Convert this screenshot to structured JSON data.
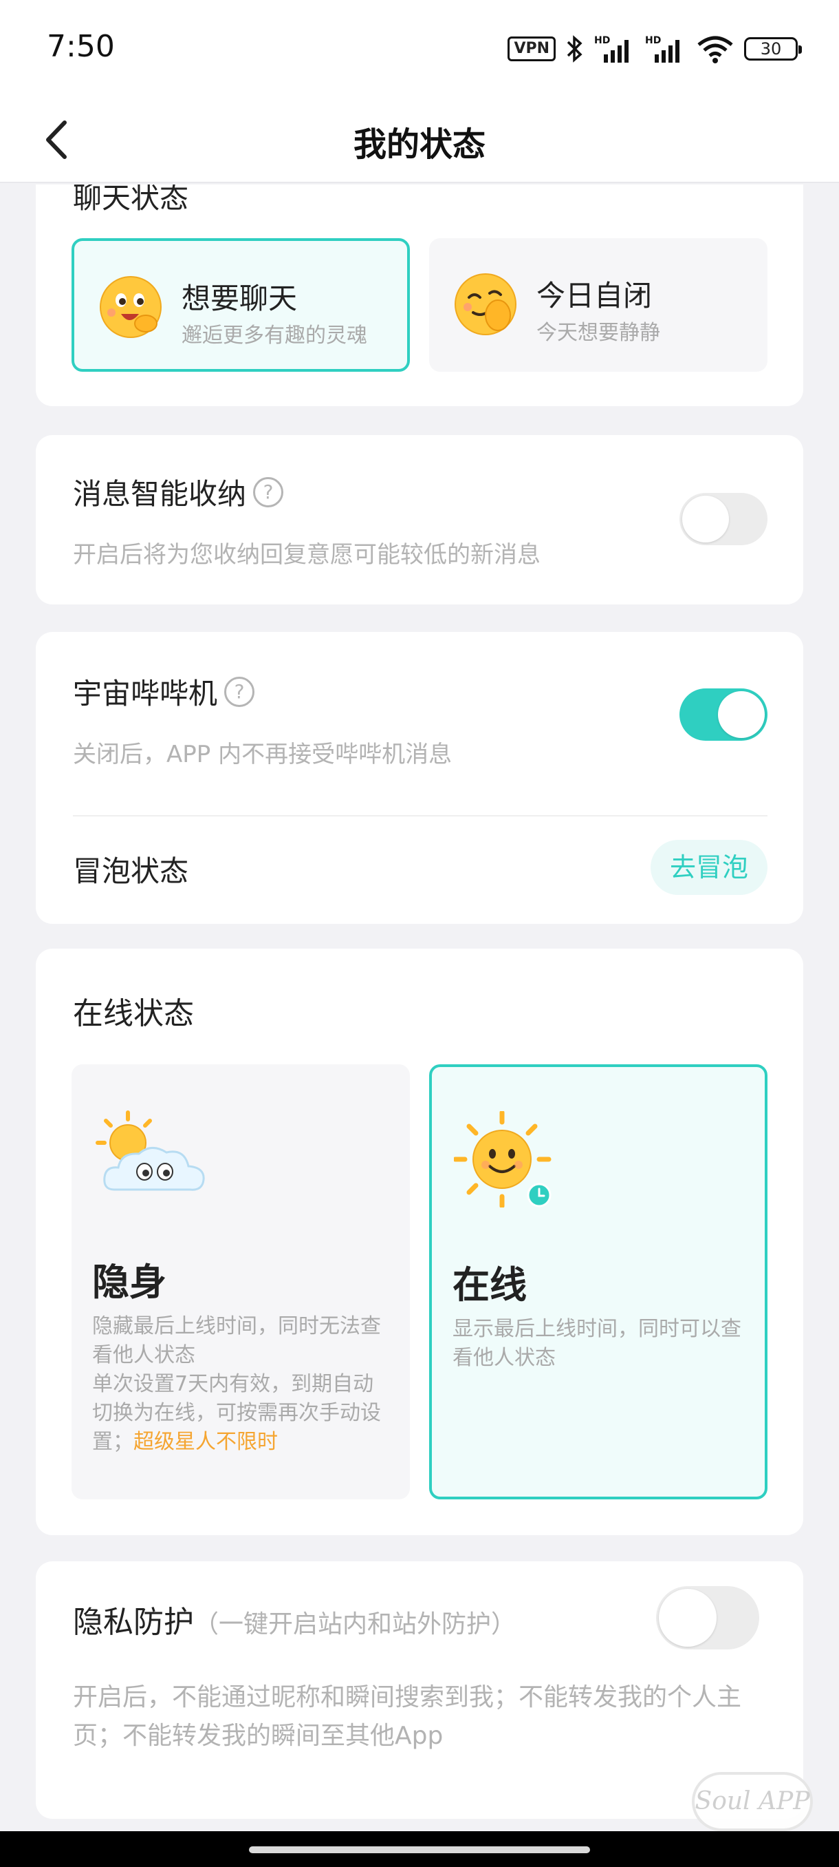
{
  "status_bar": {
    "time": "7:50",
    "vpn": "VPN",
    "battery": "30",
    "icons": [
      "vpn-icon",
      "bluetooth-icon",
      "hd-signal-icon",
      "hd-signal-icon",
      "wifi-icon",
      "battery-icon"
    ]
  },
  "header": {
    "title": "我的状态"
  },
  "chat_status": {
    "title_partial": "聊天状态",
    "options": [
      {
        "title": "想要聊天",
        "subtitle": "邂逅更多有趣的灵魂",
        "selected": true
      },
      {
        "title": "今日自闭",
        "subtitle": "今天想要静静",
        "selected": false
      }
    ]
  },
  "message_fold": {
    "title": "消息智能收纳",
    "help": "?",
    "description": "开启后将为您收纳回复意愿可能较低的新消息",
    "enabled": false
  },
  "bibi": {
    "title": "宇宙哔哔机",
    "help": "?",
    "description": "关闭后，APP 内不再接受哔哔机消息",
    "enabled": true
  },
  "bubble": {
    "title": "冒泡状态",
    "button": "去冒泡"
  },
  "online_status": {
    "title": "在线状态",
    "options": [
      {
        "title": "隐身",
        "desc_line1": "隐藏最后上线时间，同时无法查看他人状态",
        "desc_line2": "单次设置7天内有效，到期自动切换为在线，可按需再次手动设置；",
        "highlight": "超级星人不限时",
        "selected": false
      },
      {
        "title": "在线",
        "desc_line1": "显示最后上线时间，同时可以查看他人状态",
        "selected": true
      }
    ]
  },
  "privacy": {
    "title": "隐私防护",
    "hint": "（一键开启站内和站外防护）",
    "description": "开启后，不能通过昵称和瞬间搜索到我；不能转发我的个人主页；不能转发我的瞬间至其他App",
    "enabled": false
  },
  "watermark": "Soul APP",
  "colors": {
    "accent": "#2fcfc1",
    "orange": "#f5a531",
    "background": "#f2f2f5"
  }
}
